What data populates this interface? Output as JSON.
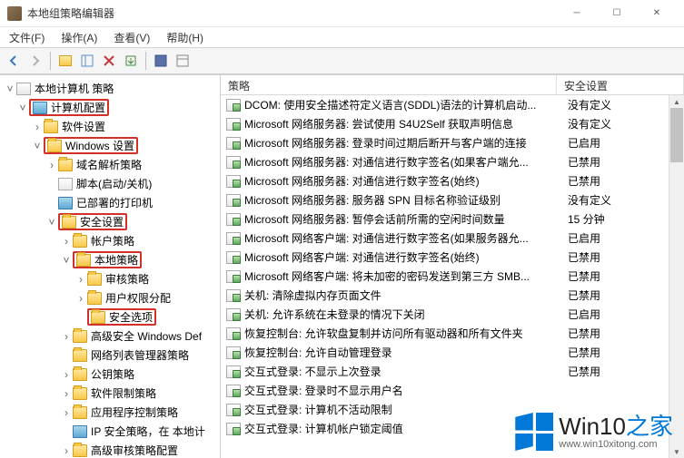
{
  "titlebar": {
    "title": "本地组策略编辑器"
  },
  "menu": {
    "file": "文件(F)",
    "action": "操作(A)",
    "view": "查看(V)",
    "help": "帮助(H)"
  },
  "columns": {
    "policy": "策略",
    "setting": "安全设置"
  },
  "tree": {
    "root": "本地计算机 策略",
    "computerConfig": "计算机配置",
    "softwareSettings": "软件设置",
    "windowsSettings": "Windows 设置",
    "nameResolution": "域名解析策略",
    "scripts": "脚本(启动/关机)",
    "deployedPrinters": "已部署的打印机",
    "securitySettings": "安全设置",
    "accountPolicies": "帐户策略",
    "localPolicies": "本地策略",
    "auditPolicy": "审核策略",
    "userRights": "用户权限分配",
    "securityOptions": "安全选项",
    "advWinDef": "高级安全 Windows Def",
    "networkList": "网络列表管理器策略",
    "publicKey": "公钥策略",
    "softwareRestrict": "软件限制策略",
    "appControl": "应用程序控制策略",
    "ipSec": "IP 安全策略，在 本地计",
    "advAudit": "高级审核策略配置"
  },
  "rows": [
    {
      "p": "DCOM: 使用安全描述符定义语言(SDDL)语法的计算机启动...",
      "s": "没有定义"
    },
    {
      "p": "Microsoft 网络服务器: 尝试使用 S4U2Self 获取声明信息",
      "s": "没有定义"
    },
    {
      "p": "Microsoft 网络服务器: 登录时间过期后断开与客户端的连接",
      "s": "已启用"
    },
    {
      "p": "Microsoft 网络服务器: 对通信进行数字签名(如果客户端允...",
      "s": "已禁用"
    },
    {
      "p": "Microsoft 网络服务器: 对通信进行数字签名(始终)",
      "s": "已禁用"
    },
    {
      "p": "Microsoft 网络服务器: 服务器 SPN 目标名称验证级别",
      "s": "没有定义"
    },
    {
      "p": "Microsoft 网络服务器: 暂停会话前所需的空闲时间数量",
      "s": "15 分钟"
    },
    {
      "p": "Microsoft 网络客户端: 对通信进行数字签名(如果服务器允...",
      "s": "已启用"
    },
    {
      "p": "Microsoft 网络客户端: 对通信进行数字签名(始终)",
      "s": "已禁用"
    },
    {
      "p": "Microsoft 网络客户端: 将未加密的密码发送到第三方 SMB...",
      "s": "已禁用"
    },
    {
      "p": "关机: 清除虚拟内存页面文件",
      "s": "已禁用"
    },
    {
      "p": "关机: 允许系统在未登录的情况下关闭",
      "s": "已启用"
    },
    {
      "p": "恢复控制台: 允许软盘复制并访问所有驱动器和所有文件夹",
      "s": "已禁用"
    },
    {
      "p": "恢复控制台: 允许自动管理登录",
      "s": "已禁用"
    },
    {
      "p": "交互式登录: 不显示上次登录",
      "s": "已禁用"
    },
    {
      "p": "交互式登录: 登录时不显示用户名",
      "s": ""
    },
    {
      "p": "交互式登录: 计算机不活动限制",
      "s": ""
    },
    {
      "p": "交互式登录: 计算机帐户锁定阈值",
      "s": ""
    }
  ],
  "watermark": {
    "brand1": "Win10",
    "brand2": "之家",
    "url": "www.win10xitong.com"
  }
}
